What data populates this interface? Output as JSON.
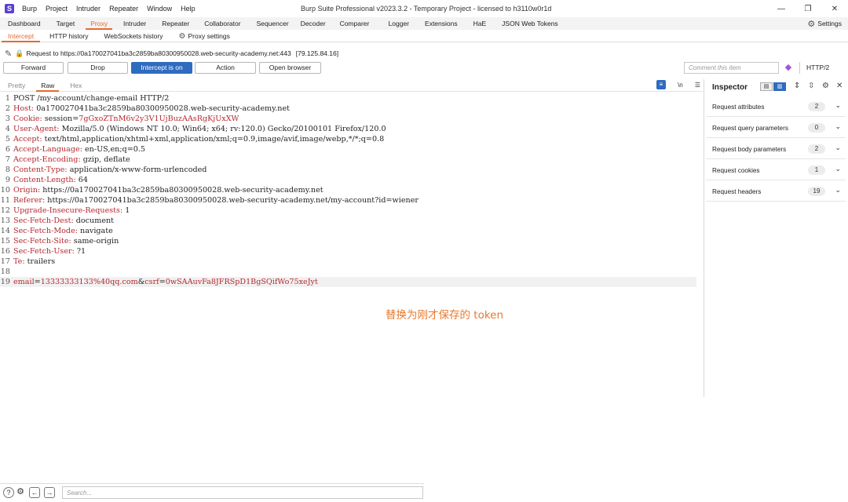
{
  "app": {
    "logo": "S",
    "menu": [
      "Burp",
      "Project",
      "Intruder",
      "Repeater",
      "Window",
      "Help"
    ],
    "window_title": "Burp Suite Professional v2023.3.2 - Temporary Project - licensed to h3110w0r1d",
    "controls": {
      "minimize": "—",
      "restore": "❐",
      "close": "✕"
    }
  },
  "main_tabs": [
    "Dashboard",
    "Target",
    "Proxy",
    "Intruder",
    "Repeater",
    "Collaborator",
    "Sequencer",
    "Decoder",
    "Comparer",
    "Logger",
    "Extensions",
    "HaE",
    "JSON Web Tokens"
  ],
  "settings_label": "Settings",
  "sub_tabs": [
    "Intercept",
    "HTTP history",
    "WebSockets history",
    "Proxy settings"
  ],
  "request": {
    "prefix": "Request to",
    "url": "https://0a170027041ba3c2859ba80300950028.web-security-academy.net:443",
    "ip": "[79.125.84.16]"
  },
  "buttons": {
    "forward": "Forward",
    "drop": "Drop",
    "intercept": "Intercept is on",
    "action": "Action",
    "open_browser": "Open browser"
  },
  "comment_placeholder": "Comment this item",
  "protocol": "HTTP/2",
  "editor_tabs": [
    "Pretty",
    "Raw",
    "Hex"
  ],
  "editor_tools": {
    "wrap": "≡",
    "newline": "\\n",
    "menu": "☰"
  },
  "request_lines": [
    {
      "n": "1",
      "key": "",
      "val": "POST /my-account/change-email HTTP/2"
    },
    {
      "n": "2",
      "key": "Host:",
      "val": " 0a170027041ba3c2859ba80300950028.web-security-academy.net"
    },
    {
      "n": "3",
      "key": "Cookie:",
      "val": " session=",
      "val2": "7gGxoZTnM6v2y3V1UjBuzAAsRgKjUxXW"
    },
    {
      "n": "4",
      "key": "User-Agent:",
      "val": " Mozilla/5.0 (Windows NT 10.0; Win64; x64; rv:120.0) Gecko/20100101 Firefox/120.0"
    },
    {
      "n": "5",
      "key": "Accept:",
      "val": " text/html,application/xhtml+xml,application/xml;q=0.9,image/avif,image/webp,*/*;q=0.8"
    },
    {
      "n": "6",
      "key": "Accept-Language:",
      "val": " en-US,en;q=0.5"
    },
    {
      "n": "7",
      "key": "Accept-Encoding:",
      "val": " gzip, deflate"
    },
    {
      "n": "8",
      "key": "Content-Type:",
      "val": " application/x-www-form-urlencoded"
    },
    {
      "n": "9",
      "key": "Content-Length:",
      "val": " 64"
    },
    {
      "n": "10",
      "key": "Origin:",
      "val": " https://0a170027041ba3c2859ba80300950028.web-security-academy.net"
    },
    {
      "n": "11",
      "key": "Referer:",
      "val": " https://0a170027041ba3c2859ba80300950028.web-security-academy.net/my-account?id=wiener"
    },
    {
      "n": "12",
      "key": "Upgrade-Insecure-Requests:",
      "val": " 1"
    },
    {
      "n": "13",
      "key": "Sec-Fetch-Dest:",
      "val": " document"
    },
    {
      "n": "14",
      "key": "Sec-Fetch-Mode:",
      "val": " navigate"
    },
    {
      "n": "15",
      "key": "Sec-Fetch-Site:",
      "val": " same-origin"
    },
    {
      "n": "16",
      "key": "Sec-Fetch-User:",
      "val": " ?1"
    },
    {
      "n": "17",
      "key": "Te:",
      "val": " trailers"
    },
    {
      "n": "18",
      "key": "",
      "val": ""
    }
  ],
  "body_line": {
    "n": "19",
    "k1": "email",
    "eq1": "=",
    "v1": "13333333133%40qq.com",
    "amp": "&",
    "k2": "csrf",
    "eq2": "=",
    "v2": "0wSAAuvFa8JFRSpD1BgSQifWo75xeJyt"
  },
  "annotation": "替换为刚才保存的 token",
  "inspector": {
    "title": "Inspector",
    "rows": [
      {
        "label": "Request attributes",
        "count": "2"
      },
      {
        "label": "Request query parameters",
        "count": "0"
      },
      {
        "label": "Request body parameters",
        "count": "2"
      },
      {
        "label": "Request cookies",
        "count": "1"
      },
      {
        "label": "Request headers",
        "count": "19"
      }
    ]
  },
  "bottom": {
    "search_placeholder": "Search..."
  },
  "colors": {
    "accent": "#e8692d",
    "primary": "#2f6bbf",
    "header_key": "#b5282f"
  }
}
